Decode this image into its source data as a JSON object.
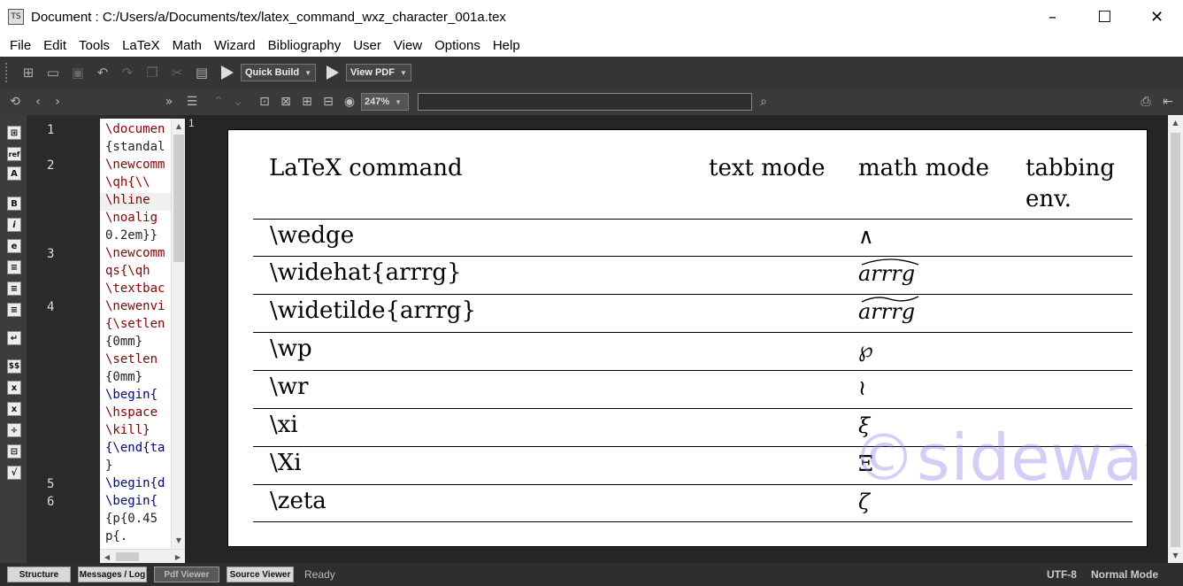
{
  "window": {
    "title": "Document : C:/Users/a/Documents/tex/latex_command_wxz_character_001a.tex",
    "app_icon": "texstudio-icon"
  },
  "menu": [
    "File",
    "Edit",
    "Tools",
    "LaTeX",
    "Math",
    "Wizard",
    "Bibliography",
    "User",
    "View",
    "Options",
    "Help"
  ],
  "toolbar": {
    "quick_build": "Quick Build",
    "view_pdf": "View PDF"
  },
  "viewer_toolbar": {
    "zoom": "247%",
    "search_value": ""
  },
  "editor": {
    "line_numbers": [
      "1",
      "2",
      "3",
      "4",
      "5",
      "6"
    ],
    "lines": [
      {
        "text": "\\documen",
        "cls": "red"
      },
      {
        "text": "{standal",
        "cls": "dark"
      },
      {
        "text": "\\newcomm",
        "cls": "red"
      },
      {
        "text": "\\qh{\\\\",
        "cls": "red"
      },
      {
        "text": "\\hline",
        "cls": "red"
      },
      {
        "text": "\\noalig",
        "cls": "red"
      },
      {
        "text": "0.2em}}",
        "cls": "dark"
      },
      {
        "text": "\\newcomm",
        "cls": "red"
      },
      {
        "text": "qs{\\qh",
        "cls": "red"
      },
      {
        "text": "\\textbac",
        "cls": "red"
      },
      {
        "text": "\\newenvi",
        "cls": "red"
      },
      {
        "text": "{\\setlen",
        "cls": "red"
      },
      {
        "text": "{0mm}",
        "cls": "dark"
      },
      {
        "text": "\\setlen",
        "cls": "red"
      },
      {
        "text": "{0mm}",
        "cls": "dark"
      },
      {
        "text": "\\begin{",
        "cls": "blue"
      },
      {
        "text": "\\hspace",
        "cls": "red"
      },
      {
        "text": "\\kill}",
        "cls": "red"
      },
      {
        "text": "{\\end{ta",
        "cls": "blue"
      },
      {
        "text": "}",
        "cls": "dark"
      },
      {
        "text": "\\begin{d",
        "cls": "blue"
      },
      {
        "text": "\\begin{",
        "cls": "blue"
      },
      {
        "text": "{p{0.45",
        "cls": "dark"
      },
      {
        "text": "p{.",
        "cls": "dark"
      }
    ]
  },
  "pdf": {
    "page_number": "1",
    "header": {
      "col1_logo": "LaTeX",
      "col1_rest": " command",
      "col2": "text mode",
      "col3": "math mode",
      "col4_line1": "tabbing",
      "col4_line2": "env."
    },
    "rows": [
      {
        "command": "\\wedge",
        "math": "∧",
        "upright": true
      },
      {
        "command": "\\widehat{arrrg}",
        "math": "arrrg",
        "accent": "hat"
      },
      {
        "command": "\\widetilde{arrrg}",
        "math": "arrrg",
        "accent": "tilde"
      },
      {
        "command": "\\wp",
        "math": "℘",
        "upright": true
      },
      {
        "command": "\\wr",
        "math": "≀",
        "upright": true
      },
      {
        "command": "\\xi",
        "math": "ξ"
      },
      {
        "command": "\\Xi",
        "math": "Ξ",
        "upright": true
      },
      {
        "command": "\\zeta",
        "math": "ζ"
      }
    ],
    "watermark": "©sideway"
  },
  "status": {
    "tabs": [
      "Structure",
      "Messages / Log",
      "Pdf Viewer",
      "Source Viewer"
    ],
    "active_tab": "Pdf Viewer",
    "message": "Ready",
    "encoding": "UTF-8",
    "mode": "Normal Mode"
  }
}
